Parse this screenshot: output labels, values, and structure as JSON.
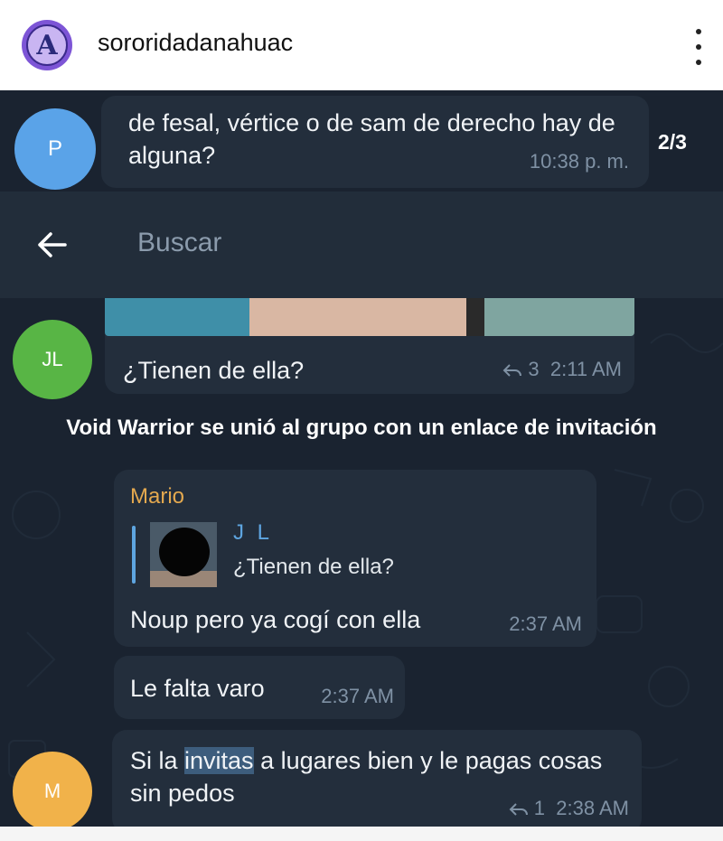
{
  "instagram": {
    "username": "sororidadanahuac",
    "avatar_letter": "A",
    "more_icon": "vertical-ellipsis-icon"
  },
  "chat": {
    "search": {
      "placeholder": "Buscar",
      "back_icon": "arrow-left-icon"
    },
    "search_counter": "2/3",
    "messages": [
      {
        "avatar": "P",
        "avatar_color": "#5aa3e8",
        "text": "de fesal, vértice o de sam de derecho hay de alguna?",
        "time": "10:38 p. m."
      },
      {
        "avatar": "JL",
        "avatar_color": "#58b545",
        "text": "¿Tienen de ella?",
        "reply_count": "3",
        "time": "2:11 AM"
      }
    ],
    "service_message": "Void Warrior se unió al grupo con un enlace de invitación",
    "reply_message": {
      "sender": "Mario",
      "sender_color": "#e4a94f",
      "quoted_name": "J L",
      "quoted_text": "¿Tienen de ella?",
      "text": "Noup pero ya cogí con ella",
      "time": "2:37 AM"
    },
    "message_short": {
      "text": "Le falta varo",
      "time": "2:37 AM"
    },
    "last_message": {
      "avatar": "M",
      "avatar_color": "#f1b24a",
      "text_before": "Si la ",
      "text_highlight": "invitas",
      "text_after": " a lugares bien y le pagas cosas sin pedos",
      "reply_count": "1",
      "time": "2:38 AM"
    },
    "colors": {
      "background": "#1a2330",
      "bubble": "#232e3c",
      "accent": "#5ea5e0",
      "highlight": "#3d5d7d"
    }
  }
}
